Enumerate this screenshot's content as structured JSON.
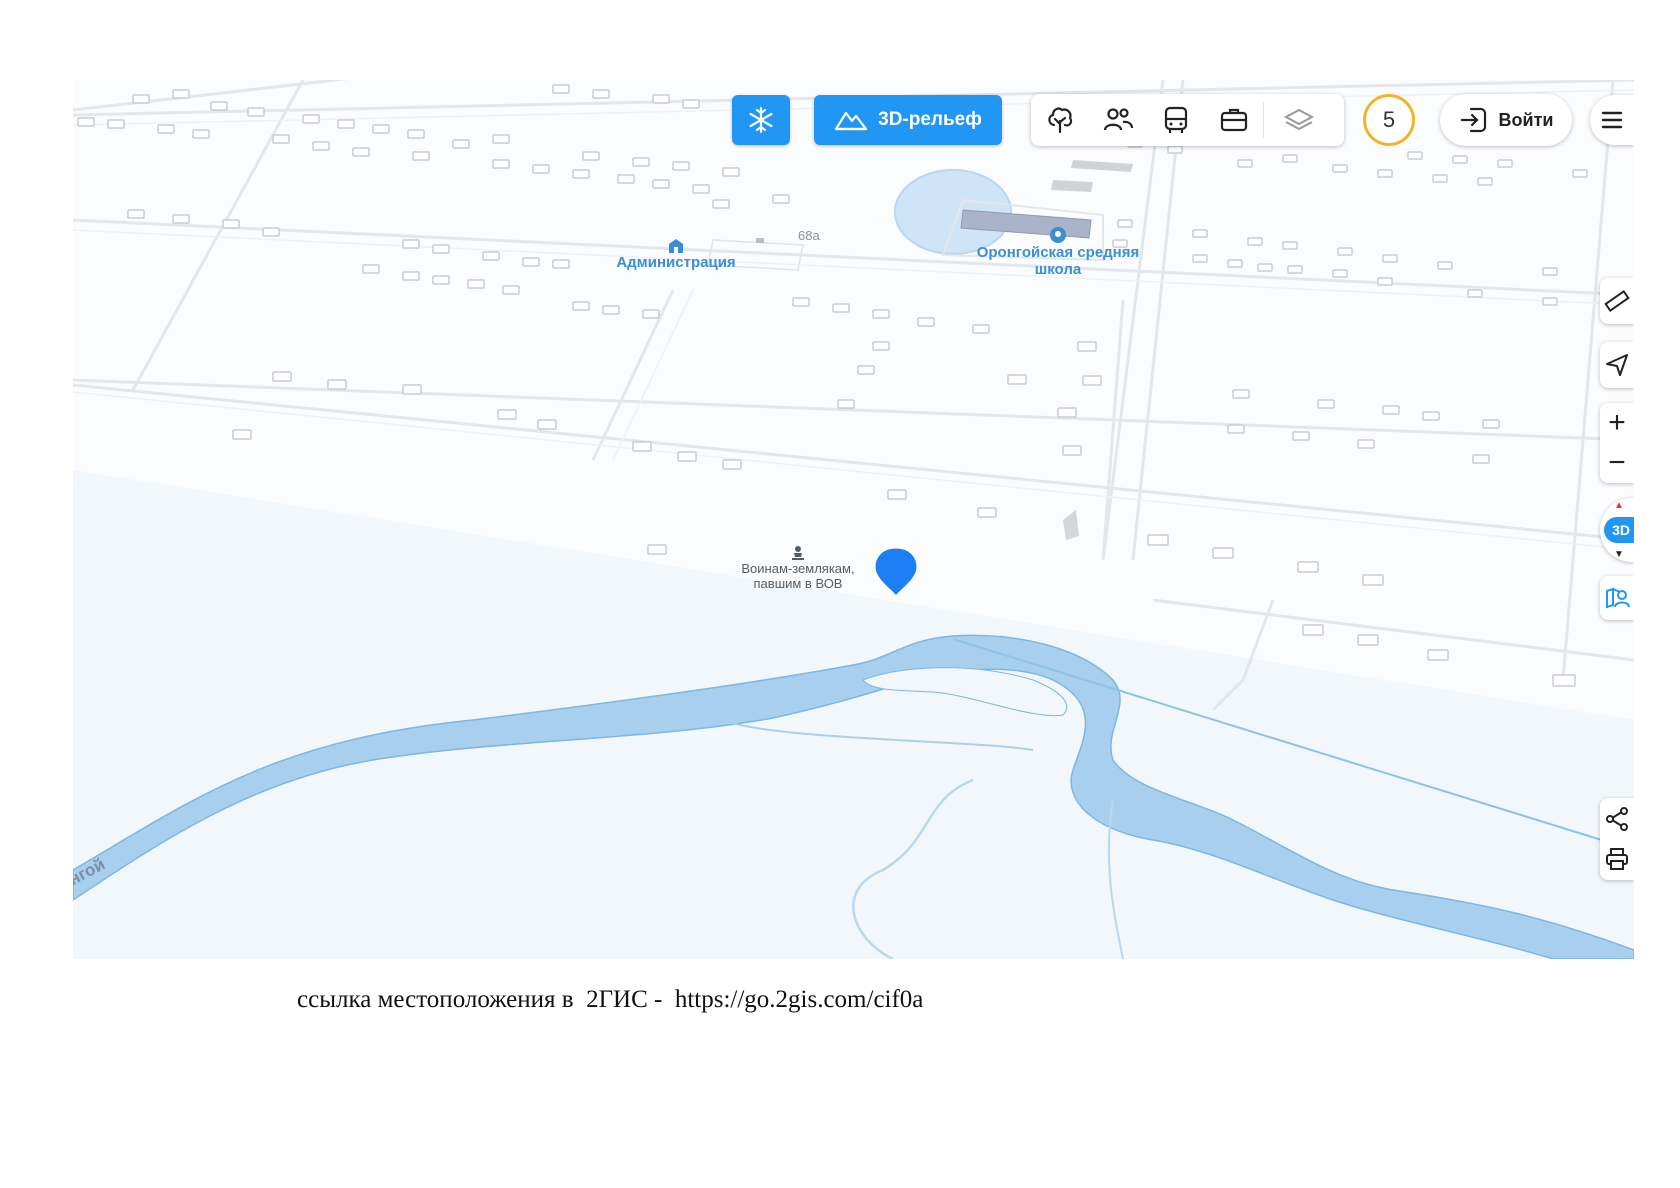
{
  "toolbar": {
    "winter_mode_icon": "snowflake-icon",
    "relief_label": "3D-рельеф",
    "relief_icon": "terrain-3d-icon",
    "layer_icons": [
      "tree-icon",
      "people-icon",
      "bus-icon",
      "briefcase-icon",
      "layers-icon"
    ],
    "notification_count": "5",
    "login_label": "Войти",
    "login_icon": "login-arrow-icon",
    "menu_icon": "menu-icon"
  },
  "side_controls": {
    "ruler_icon": "ruler-icon",
    "locate_icon": "locate-arrow-icon",
    "zoom_in": "+",
    "zoom_out": "−",
    "compass_label": "3D",
    "bookmark_icon": "map-pin-person-icon",
    "share_icon": "share-icon",
    "print_icon": "print-icon"
  },
  "map": {
    "labels": {
      "admin": "Администрация",
      "school_line1": "Оронгойская средняя",
      "school_line2": "школа",
      "address": "68а",
      "memorial_line1": "Воинам-землякам,",
      "memorial_line2": "павшим в ВОВ",
      "river": "нгой"
    },
    "colors": {
      "water": "#a8d0ee",
      "water_edge": "#7cb6e2",
      "marker": "#1d7ef5",
      "poi_text": "#3a8fd4",
      "accent_badge": "#f0b429"
    }
  },
  "caption": {
    "text": "ссылка местоположения в  2ГИС -  https://go.2gis.com/cif0a"
  }
}
